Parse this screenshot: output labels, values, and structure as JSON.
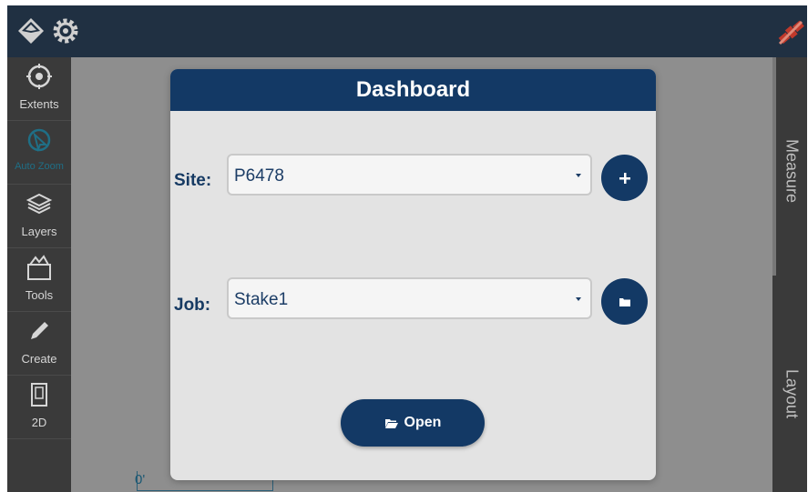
{
  "sidebar": {
    "items": [
      {
        "label": "Extents",
        "icon": "extents-icon"
      },
      {
        "label": "Auto Zoom",
        "icon": "auto-zoom-icon"
      },
      {
        "label": "Layers",
        "icon": "layers-icon"
      },
      {
        "label": "Tools",
        "icon": "tools-icon"
      },
      {
        "label": "Create",
        "icon": "pencil-icon"
      },
      {
        "label": "2D",
        "icon": "2d-view-icon"
      }
    ]
  },
  "right_tabs": {
    "measure": "Measure",
    "layout": "Layout"
  },
  "canvas": {
    "scale_label": "0'"
  },
  "dialog": {
    "title": "Dashboard",
    "site": {
      "label": "Site:",
      "value": "P6478",
      "button_icon": "plus-icon"
    },
    "job": {
      "label": "Job:",
      "value": "Stake1",
      "button_icon": "folder-icon"
    },
    "open_label": "Open"
  },
  "colors": {
    "header": "#133965",
    "topbar": "#203042",
    "sidebar": "#3a3a3a",
    "active_accent": "#1f6f86",
    "gps_status": "#c0392b"
  }
}
